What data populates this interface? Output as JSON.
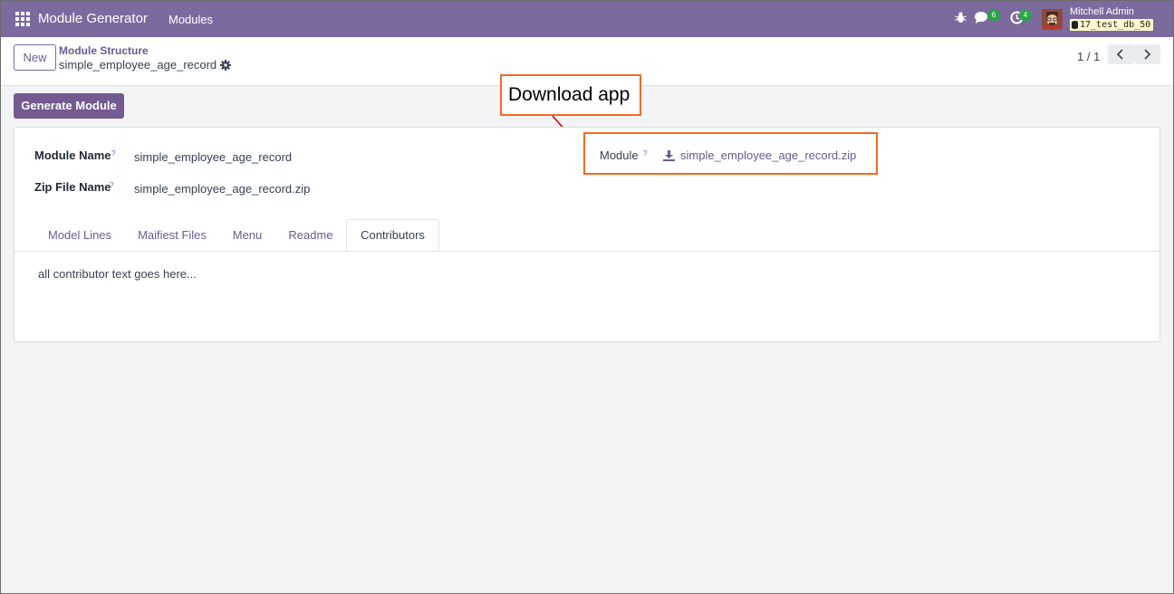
{
  "navbar": {
    "app_title": "Module Generator",
    "menu_item": "Modules",
    "chat_count": "6",
    "activity_count": "4",
    "user_name": "Mitchell Admin",
    "database": "17_test_db_50"
  },
  "control_panel": {
    "new_label": "New",
    "breadcrumb": "Module Structure",
    "record_name": "simple_employee_age_record",
    "pager": "1 / 1"
  },
  "actions": {
    "generate_label": "Generate Module"
  },
  "form": {
    "module_name_label": "Module Name",
    "module_name_value": "simple_employee_age_record",
    "zip_file_label": "Zip File Name",
    "zip_file_value": "simple_employee_age_record.zip",
    "module_label": "Module",
    "module_file": "simple_employee_age_record.zip",
    "help_marker": "?"
  },
  "tabs": [
    {
      "label": "Model Lines"
    },
    {
      "label": "Maifiest Files"
    },
    {
      "label": "Menu"
    },
    {
      "label": "Readme"
    },
    {
      "label": "Contributors"
    }
  ],
  "active_tab_content": "all contributor text goes here...",
  "annotation": {
    "label": "Download app",
    "color": "#f26a21"
  },
  "colors": {
    "brand": "#7c6a9e",
    "primary_button": "#735a90",
    "badge": "#28a745"
  }
}
